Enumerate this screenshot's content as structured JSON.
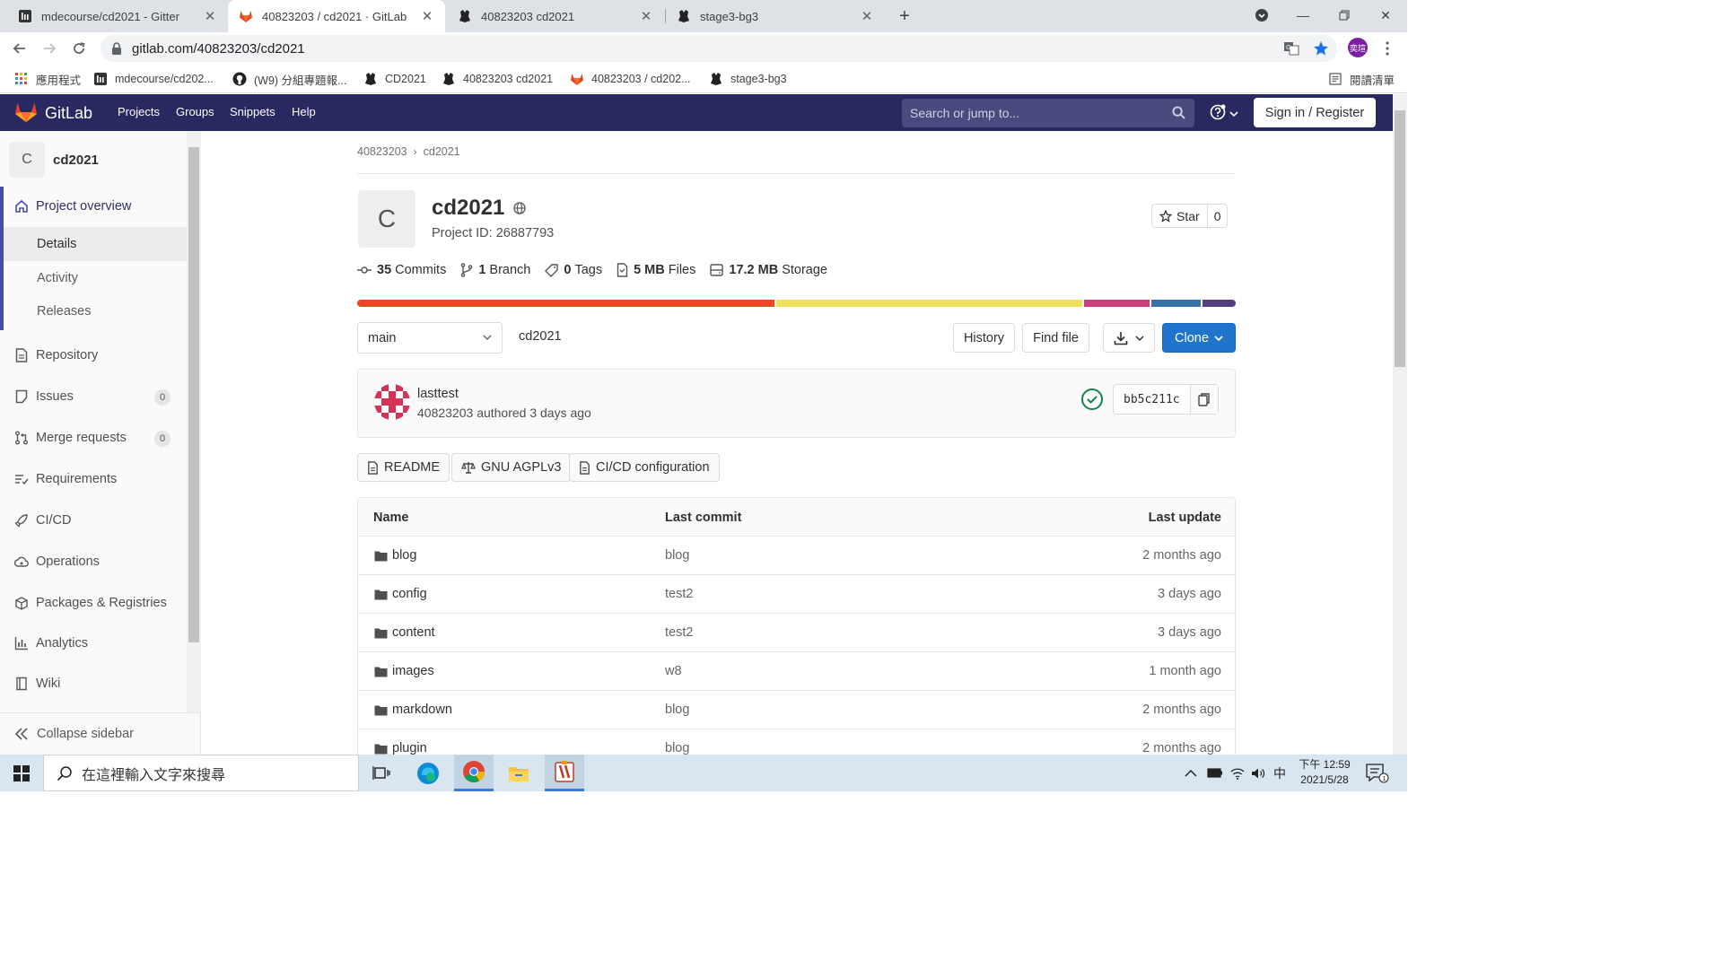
{
  "browser": {
    "tabs": [
      {
        "title": "mdecourse/cd2021 - Gitter",
        "icon": "gitter-icon"
      },
      {
        "title": "40823203 / cd2021 · GitLab",
        "icon": "gitlab-icon"
      },
      {
        "title": "40823203 cd2021",
        "icon": "hugo-icon"
      },
      {
        "title": "stage3-bg3",
        "icon": "hugo-icon"
      }
    ],
    "url": "gitlab.com/40823203/cd2021",
    "profile_initials": "奕瑄",
    "bookmarks": [
      {
        "label": "應用程式",
        "icon": "apps-grid-icon"
      },
      {
        "label": "mdecourse/cd202...",
        "icon": "gitter-icon"
      },
      {
        "label": "(W9) 分組專題報...",
        "icon": "github-icon"
      },
      {
        "label": "CD2021",
        "icon": "hugo-icon"
      },
      {
        "label": "40823203 cd2021",
        "icon": "hugo-icon"
      },
      {
        "label": "40823203 / cd202...",
        "icon": "gitlab-icon"
      },
      {
        "label": "stage3-bg3",
        "icon": "hugo-icon"
      }
    ],
    "reading_list": "閱讀清單"
  },
  "gitlab_header": {
    "brand": "GitLab",
    "nav": [
      "Projects",
      "Groups",
      "Snippets",
      "Help"
    ],
    "search_placeholder": "Search or jump to...",
    "sign_in": "Sign in / Register"
  },
  "sidebar": {
    "project_initial": "C",
    "project_name": "cd2021",
    "overview": "Project overview",
    "sub_items": [
      "Details",
      "Activity",
      "Releases"
    ],
    "items": [
      {
        "label": "Repository",
        "icon": "file-icon"
      },
      {
        "label": "Issues",
        "icon": "issues-icon",
        "badge": "0"
      },
      {
        "label": "Merge requests",
        "icon": "merge-request-icon",
        "badge": "0"
      },
      {
        "label": "Requirements",
        "icon": "requirements-icon"
      },
      {
        "label": "CI/CD",
        "icon": "rocket-icon"
      },
      {
        "label": "Operations",
        "icon": "cloud-gear-icon"
      },
      {
        "label": "Packages & Registries",
        "icon": "package-icon"
      },
      {
        "label": "Analytics",
        "icon": "chart-icon"
      },
      {
        "label": "Wiki",
        "icon": "book-icon"
      }
    ],
    "collapse": "Collapse sidebar"
  },
  "breadcrumb": [
    "40823203",
    "cd2021"
  ],
  "project": {
    "initial": "C",
    "name": "cd2021",
    "id_text": "Project ID: 26887793",
    "star_label": "Star",
    "star_count": "0"
  },
  "stats": [
    {
      "value": "35",
      "label": "Commits",
      "icon": "commit-icon"
    },
    {
      "value": "1",
      "label": "Branch",
      "icon": "branch-icon"
    },
    {
      "value": "0",
      "label": "Tags",
      "icon": "tag-icon"
    },
    {
      "value": "5 MB",
      "label": "Files",
      "icon": "doc-icon"
    },
    {
      "value": "17.2 MB",
      "label": "Storage",
      "icon": "storage-icon"
    }
  ],
  "language_bar": [
    {
      "share": 47.5,
      "color": "#e34c26"
    },
    {
      "share": 34.8,
      "color": "#f1e05a"
    },
    {
      "share": 7.5,
      "color": "#cc3e7b"
    },
    {
      "share": 5.6,
      "color": "#3572a5"
    },
    {
      "share": 3.8,
      "color": "#563d7c"
    }
  ],
  "repo_controls": {
    "branch": "main",
    "path": "cd2021",
    "history": "History",
    "find_file": "Find file",
    "clone": "Clone"
  },
  "last_commit": {
    "title": "lasttest",
    "author": "40823203",
    "meta": "authored 3 days ago",
    "sha": "bb5c211c"
  },
  "quick_buttons": [
    {
      "label": "README",
      "icon": "doc-icon"
    },
    {
      "label": "GNU AGPLv3",
      "icon": "scale-icon"
    },
    {
      "label": "CI/CD configuration",
      "icon": "doc-icon"
    }
  ],
  "file_tree": {
    "headers": {
      "name": "Name",
      "last_commit": "Last commit",
      "last_update": "Last update"
    },
    "rows": [
      {
        "name": "blog",
        "commit": "blog",
        "updated": "2 months ago"
      },
      {
        "name": "config",
        "commit": "test2",
        "updated": "3 days ago"
      },
      {
        "name": "content",
        "commit": "test2",
        "updated": "3 days ago"
      },
      {
        "name": "images",
        "commit": "w8",
        "updated": "1 month ago"
      },
      {
        "name": "markdown",
        "commit": "blog",
        "updated": "2 months ago"
      },
      {
        "name": "plugin",
        "commit": "blog",
        "updated": "2 months ago"
      }
    ]
  },
  "taskbar": {
    "search_placeholder": "在這裡輸入文字來搜尋",
    "ime": "中",
    "time": "下午 12:59",
    "date": "2021/5/28",
    "notification_count": "1"
  }
}
